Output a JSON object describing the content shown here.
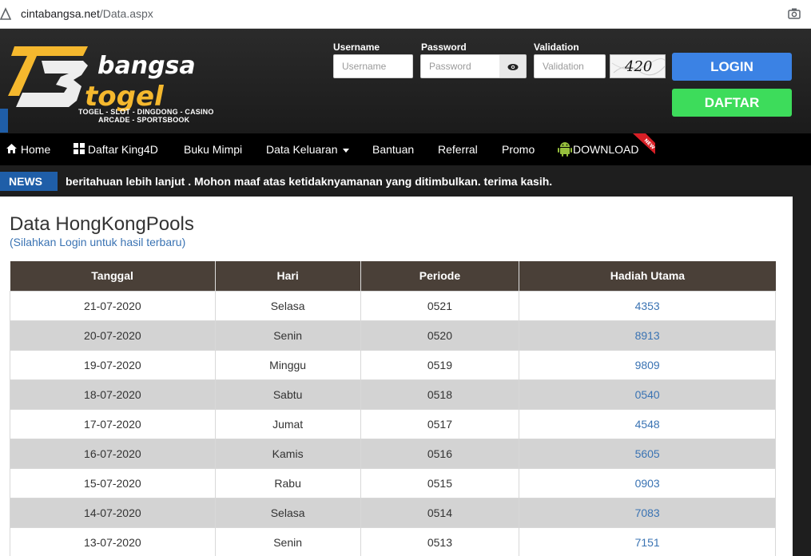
{
  "browser": {
    "url_host": "cintabangsa.net",
    "url_path": "/Data.aspx"
  },
  "logo": {
    "word1": "bangsa",
    "word2": "togel",
    "tagline1": "TOGEL - SLOT - DINGDONG - CASINO",
    "tagline2": "ARCADE - SPORTSBOOK"
  },
  "login": {
    "username_label": "Username",
    "username_placeholder": "Username",
    "password_label": "Password",
    "password_placeholder": "Password",
    "validation_label": "Validation",
    "validation_placeholder": "Validation",
    "captcha_value": "420",
    "login_button": "LOGIN",
    "daftar_button": "DAFTAR"
  },
  "nav": {
    "items": [
      {
        "label": "Home",
        "icon": "home-icon"
      },
      {
        "label": "Daftar King4D",
        "icon": "grid-icon"
      },
      {
        "label": "Buku Mimpi"
      },
      {
        "label": "Data Keluaran"
      },
      {
        "label": "Bantuan"
      },
      {
        "label": "Referral"
      },
      {
        "label": "Promo"
      },
      {
        "label": "DOWNLOAD",
        "icon": "android-icon"
      }
    ],
    "new_badge": "NEW"
  },
  "news": {
    "tag": "NEWS",
    "text": "beritahuan lebih lanjut . Mohon maaf atas ketidaknyamanan yang ditimbulkan. terima kasih."
  },
  "main": {
    "title": "Data HongKongPools",
    "subtitle": "(Silahkan Login untuk hasil terbaru)",
    "columns": [
      "Tanggal",
      "Hari",
      "Periode",
      "Hadiah Utama"
    ],
    "rows": [
      {
        "tanggal": "21-07-2020",
        "hari": "Selasa",
        "periode": "0521",
        "hadiah": "4353"
      },
      {
        "tanggal": "20-07-2020",
        "hari": "Senin",
        "periode": "0520",
        "hadiah": "8913"
      },
      {
        "tanggal": "19-07-2020",
        "hari": "Minggu",
        "periode": "0519",
        "hadiah": "9809"
      },
      {
        "tanggal": "18-07-2020",
        "hari": "Sabtu",
        "periode": "0518",
        "hadiah": "0540"
      },
      {
        "tanggal": "17-07-2020",
        "hari": "Jumat",
        "periode": "0517",
        "hadiah": "4548"
      },
      {
        "tanggal": "16-07-2020",
        "hari": "Kamis",
        "periode": "0516",
        "hadiah": "5605"
      },
      {
        "tanggal": "15-07-2020",
        "hari": "Rabu",
        "periode": "0515",
        "hadiah": "0903"
      },
      {
        "tanggal": "14-07-2020",
        "hari": "Selasa",
        "periode": "0514",
        "hadiah": "7083"
      },
      {
        "tanggal": "13-07-2020",
        "hari": "Senin",
        "periode": "0513",
        "hadiah": "7151"
      }
    ]
  }
}
